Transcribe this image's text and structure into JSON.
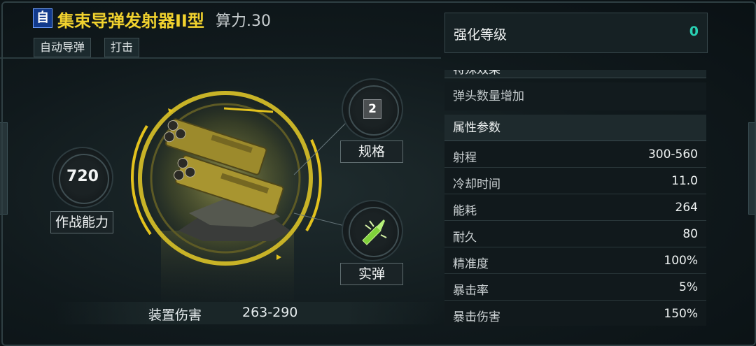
{
  "header": {
    "type_badge": "自",
    "weapon_name": "集束导弹发射器II型",
    "power": "算力.30",
    "tags": [
      "自动导弹",
      "打击"
    ]
  },
  "ability": {
    "value": "720",
    "label": "作战能力"
  },
  "spec": {
    "value": "2",
    "label": "规格"
  },
  "ammo": {
    "label": "实弹",
    "icon": "ammo-icon"
  },
  "damage": {
    "label": "装置伤害",
    "value": "263-290"
  },
  "enhance": {
    "label": "强化等级",
    "value": "0"
  },
  "effects": {
    "title": "特殊效果",
    "items": [
      "弹头数量增加"
    ]
  },
  "stats": {
    "title": "属性参数",
    "rows": [
      {
        "name": "射程",
        "value": "300-560"
      },
      {
        "name": "冷却时间",
        "value": "11.0"
      },
      {
        "name": "能耗",
        "value": "264"
      },
      {
        "name": "耐久",
        "value": "80"
      },
      {
        "name": "精准度",
        "value": "100%"
      },
      {
        "name": "暴击率",
        "value": "5%"
      },
      {
        "name": "暴击伤害",
        "value": "150%"
      }
    ]
  },
  "colors": {
    "accent_yellow": "#f1d22e",
    "enhance_teal": "#29d0b2",
    "badge_blue": "#123a8c"
  }
}
